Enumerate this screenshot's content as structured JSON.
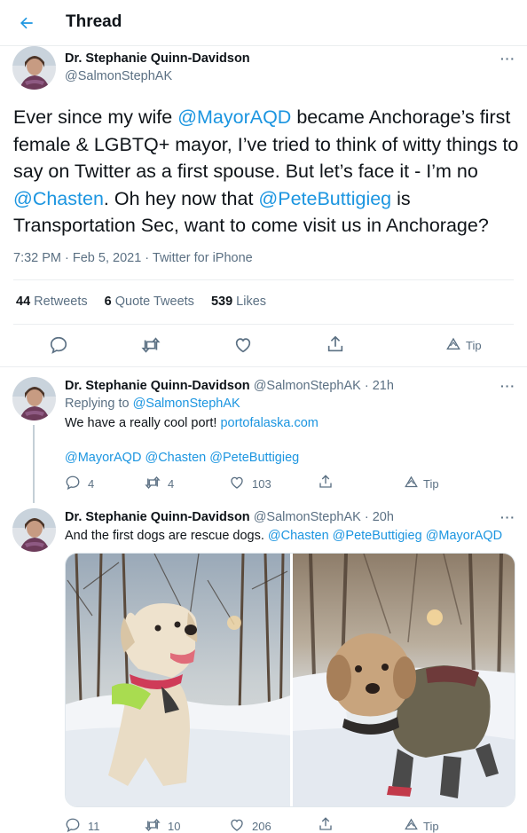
{
  "header": {
    "title": "Thread"
  },
  "main_tweet": {
    "author_name": "Dr. Stephanie Quinn-Davidson",
    "author_handle": "@SalmonStephAK",
    "text_parts": [
      "Ever since my wife ",
      "@MayorAQD",
      " became Anchorage’s first female & LGBTQ+ mayor, I’ve tried to think of witty things to say on Twitter as a first spouse. But let’s face it - I’m no ",
      "@Chasten",
      ". Oh hey now that ",
      "@PeteButtigieg",
      " is Transportation Sec, want to come visit us in Anchorage?"
    ],
    "meta": "7:32 PM · Feb 5, 2021 · Twitter for iPhone",
    "stats": {
      "retweets_count": "44",
      "retweets_label": "Retweets",
      "quotes_count": "6",
      "quotes_label": "Quote Tweets",
      "likes_count": "539",
      "likes_label": "Likes"
    },
    "tip_label": "Tip"
  },
  "reply1": {
    "author_name": "Dr. Stephanie Quinn-Davidson",
    "author_handle": "@SalmonStephAK",
    "time": "· 21h",
    "replying_prefix": "Replying to",
    "replying_to": "@SalmonStephAK",
    "text": "We have a really cool port! ",
    "link": "portofalaska.com",
    "mentions": [
      "@MayorAQD",
      "@Chasten",
      "@PeteButtigieg"
    ],
    "reply_count": "4",
    "retweet_count": "4",
    "like_count": "103",
    "tip_label": "Tip"
  },
  "reply2": {
    "author_name": "Dr. Stephanie Quinn-Davidson",
    "author_handle": "@SalmonStephAK",
    "time": "· 20h",
    "text": "And the first dogs are rescue dogs. ",
    "mentions": [
      "@Chasten",
      "@PeteButtigieg",
      "@MayorAQD"
    ],
    "reply_count": "11",
    "retweet_count": "10",
    "like_count": "206",
    "tip_label": "Tip"
  },
  "colors": {
    "accent": "#1b95e0",
    "muted": "#5b7083",
    "text": "#0f1419",
    "border": "#ebeef0"
  },
  "icons": [
    "back-arrow-icon",
    "more-icon",
    "reply-icon",
    "retweet-icon",
    "like-icon",
    "share-icon",
    "tip-icon"
  ]
}
